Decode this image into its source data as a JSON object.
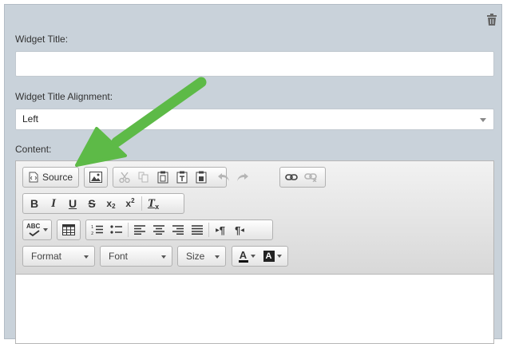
{
  "widget": {
    "title_label": "Widget Title:",
    "title_value": "",
    "alignment_label": "Widget Title Alignment:",
    "alignment_value": "Left",
    "content_label": "Content:"
  },
  "editor": {
    "source_label": "Source",
    "format_label": "Format",
    "font_label": "Font",
    "size_label": "Size",
    "text_color_label": "A",
    "bg_color_label": "A",
    "bold": "B",
    "italic": "I",
    "underline": "U",
    "strike": "S",
    "subscript": "x",
    "subscript_mark": "2",
    "superscript": "x",
    "superscript_mark": "2",
    "remove_format": "T",
    "remove_format_mark": "x",
    "spellcheck": "ABC",
    "ltr": "¶",
    "rtl": "¶",
    "content": ""
  },
  "colors": {
    "panel_bg": "#c9d2da",
    "arrow": "#5dba47"
  },
  "icons": [
    "trash-icon",
    "source-icon",
    "image-icon",
    "cut-icon",
    "copy-icon",
    "paste-icon",
    "paste-text-icon",
    "paste-word-icon",
    "undo-icon",
    "redo-icon",
    "link-icon",
    "unlink-icon",
    "spellcheck-icon",
    "table-icon",
    "numbered-list-icon",
    "bulleted-list-icon",
    "align-left-icon",
    "align-center-icon",
    "align-right-icon",
    "justify-icon",
    "ltr-icon",
    "rtl-icon"
  ]
}
